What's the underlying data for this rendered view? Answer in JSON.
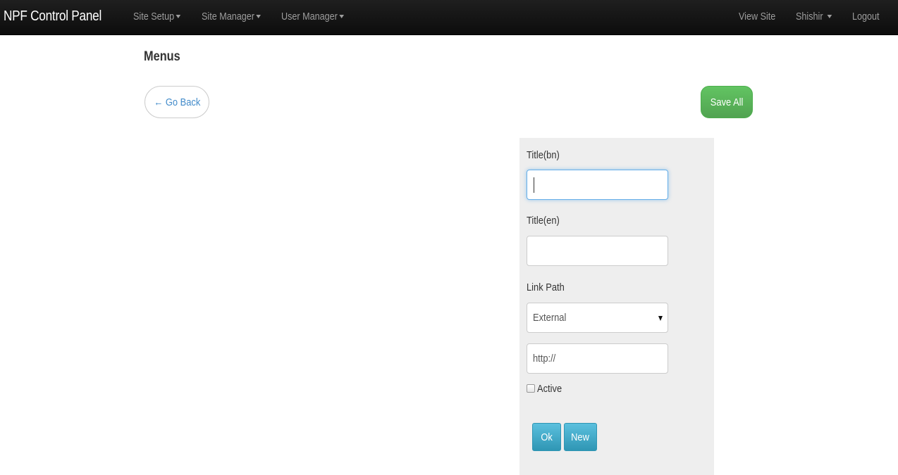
{
  "navbar": {
    "brand": "NPF Control Panel",
    "menus": [
      {
        "label": "Site Setup"
      },
      {
        "label": "Site Manager"
      },
      {
        "label": "User Manager"
      }
    ],
    "right": {
      "view_site": "View Site",
      "user": "Shishir",
      "logout": "Logout"
    }
  },
  "page": {
    "title": "Menus",
    "back_button": "← Go Back",
    "save_all_button": "Save All"
  },
  "form": {
    "title_bn": {
      "label": "Title(bn)",
      "value": ""
    },
    "title_en": {
      "label": "Title(en)",
      "value": ""
    },
    "link_path": {
      "label": "Link Path",
      "selected": "External"
    },
    "url": {
      "value": "http://"
    },
    "active": {
      "label": "Active",
      "checked": false
    },
    "ok_button": "Ok",
    "new_button": "New"
  },
  "colors": {
    "navbar_bg": "#1a1a1a",
    "nav_text": "#9d9d9d",
    "link_blue": "#428bca",
    "success_green": "#5cb85c",
    "info_blue": "#3ba5c9",
    "panel_bg": "#eeeeee",
    "focus_border": "#66afe9"
  }
}
